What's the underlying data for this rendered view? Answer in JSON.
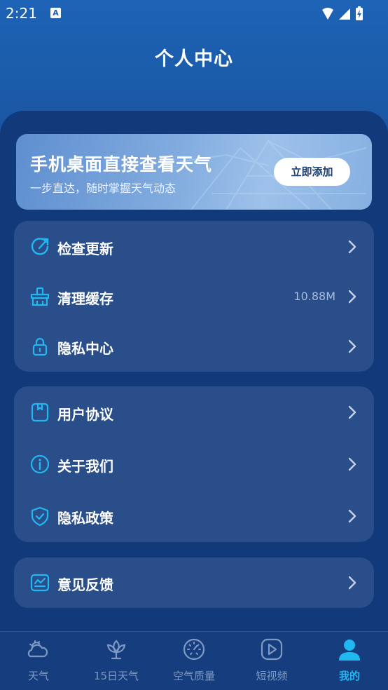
{
  "status_bar": {
    "time": "2:21",
    "notification_letter": "A"
  },
  "header": {
    "title": "个人中心"
  },
  "banner": {
    "title": "手机桌面直接查看天气",
    "subtitle": "一步直达，随时掌握天气动态",
    "button": "立即添加"
  },
  "group1": [
    {
      "label": "检查更新",
      "value": "",
      "icon": "refresh-icon"
    },
    {
      "label": "清理缓存",
      "value": "10.88M",
      "icon": "broom-icon"
    },
    {
      "label": "隐私中心",
      "value": "",
      "icon": "lock-icon"
    }
  ],
  "group2": [
    {
      "label": "用户协议",
      "icon": "document-icon"
    },
    {
      "label": "关于我们",
      "icon": "info-icon"
    },
    {
      "label": "隐私政策",
      "icon": "shield-icon"
    }
  ],
  "group3": [
    {
      "label": "意见反馈",
      "icon": "feedback-icon"
    }
  ],
  "tabs": [
    {
      "label": "天气",
      "icon": "weather-icon",
      "active": false
    },
    {
      "label": "15日天气",
      "icon": "flower-icon",
      "active": false
    },
    {
      "label": "空气质量",
      "icon": "gauge-icon",
      "active": false
    },
    {
      "label": "短视频",
      "icon": "play-icon",
      "active": false
    },
    {
      "label": "我的",
      "icon": "person-icon",
      "active": true
    }
  ],
  "colors": {
    "accent": "#21b8f2",
    "card": "#294e89",
    "panel": "#123a7a",
    "tab_inactive": "#7d99c4"
  }
}
